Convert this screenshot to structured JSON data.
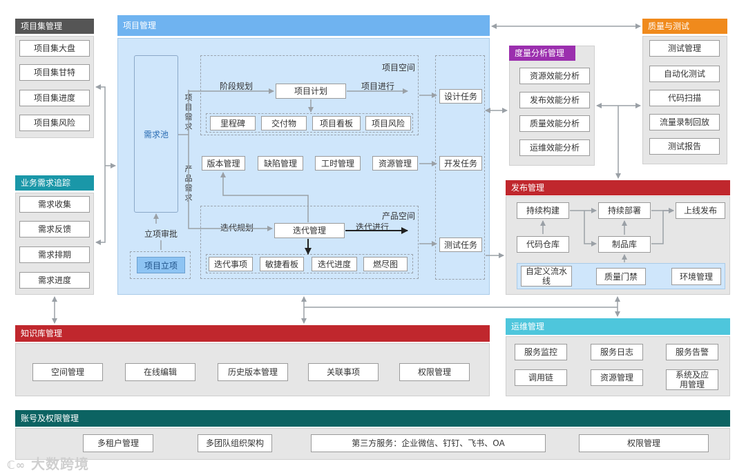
{
  "colors": {
    "gray_header": "#555555",
    "blue_header": "#6fb3f0",
    "orange_header": "#f08a1c",
    "purple_header": "#9b2fae",
    "red_header": "#c0272d",
    "teal_header": "#1a97a8",
    "cyan_header": "#4ec6dc",
    "green_header": "#0c6362",
    "project_bg": "#cfe6fb"
  },
  "portfolio": {
    "title": "项目集管理",
    "items": [
      "项目集大盘",
      "项目集甘特",
      "项目集进度",
      "项目集风险"
    ]
  },
  "requirement_tracking": {
    "title": "业务需求追踪",
    "items": [
      "需求收集",
      "需求反馈",
      "需求排期",
      "需求进度"
    ]
  },
  "project_mgmt": {
    "title": "项目管理",
    "demand_pool": "需求池",
    "approval_label": "立项审批",
    "project_init": "项目立项",
    "project_demand_label": "项目需求",
    "product_demand_label": "产品需求",
    "project_space": {
      "title": "项目空间",
      "phase_planning": "阶段规划",
      "project_plan": "项目计划",
      "project_progress": "项目进行",
      "items": [
        "里程碑",
        "交付物",
        "项目看板",
        "项目风险"
      ]
    },
    "mid_items": [
      "版本管理",
      "缺陷管理",
      "工时管理",
      "资源管理"
    ],
    "product_space": {
      "title": "产品空间",
      "iteration_planning": "迭代规划",
      "iteration_mgmt": "迭代管理",
      "iteration_progress": "迭代进行",
      "items": [
        "迭代事项",
        "敏捷看板",
        "迭代进度",
        "燃尽图"
      ]
    },
    "tasks": [
      "设计任务",
      "开发任务",
      "测试任务"
    ]
  },
  "metrics": {
    "title": "度量分析管理",
    "items": [
      "资源效能分析",
      "发布效能分析",
      "质量效能分析",
      "运维效能分析"
    ]
  },
  "quality": {
    "title": "质量与测试",
    "items": [
      "测试管理",
      "自动化测试",
      "代码扫描",
      "流量录制回放",
      "测试报告"
    ]
  },
  "release": {
    "title": "发布管理",
    "continuous_build": "持续构建",
    "continuous_deploy": "持续部署",
    "go_live": "上线发布",
    "code_repo": "代码仓库",
    "artifact_repo": "制品库",
    "custom_pipeline": "自定义流水线",
    "quality_gate": "质量门禁",
    "env_mgmt": "环境管理"
  },
  "knowledge": {
    "title": "知识库管理",
    "items": [
      "空间管理",
      "在线编辑",
      "历史版本管理",
      "关联事项",
      "权限管理"
    ]
  },
  "ops": {
    "title": "运维管理",
    "items": [
      "服务监控",
      "服务日志",
      "服务告警",
      "调用链",
      "资源管理",
      "系统及应用管理"
    ]
  },
  "account": {
    "title": "账号及权限管理",
    "items": [
      "多租户管理",
      "多团队组织架构",
      "第三方服务：企业微信、钉钉、飞书、OA",
      "权限管理"
    ]
  },
  "watermark": "大数跨境"
}
